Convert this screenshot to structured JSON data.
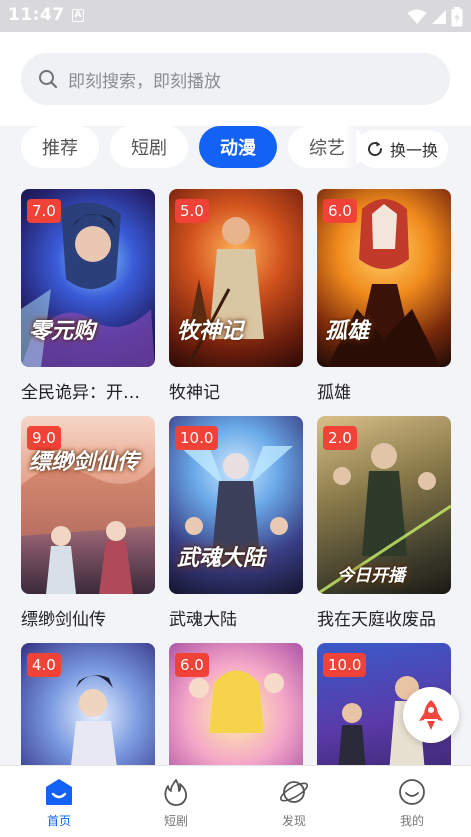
{
  "status_bar": {
    "time": "11:47",
    "notif_glyph": "A"
  },
  "search": {
    "placeholder": "即刻搜索，即刻播放"
  },
  "tabs": [
    {
      "label": "推荐",
      "active": false
    },
    {
      "label": "短剧",
      "active": false
    },
    {
      "label": "动漫",
      "active": true
    },
    {
      "label": "综艺",
      "active": false
    }
  ],
  "refresh_label": "换一换",
  "cards": [
    {
      "title": "全民诡异：开…",
      "rating": "7.0"
    },
    {
      "title": "牧神记",
      "rating": "5.0"
    },
    {
      "title": "孤雄",
      "rating": "6.0"
    },
    {
      "title": "缥缈剑仙传",
      "rating": "9.0"
    },
    {
      "title": "武魂大陆",
      "rating": "10.0"
    },
    {
      "title": "我在天庭收废品",
      "rating": "2.0"
    },
    {
      "title": "",
      "rating": "4.0"
    },
    {
      "title": "",
      "rating": "6.0"
    },
    {
      "title": "",
      "rating": "10.0"
    }
  ],
  "cover_art_text": [
    "零元购",
    "牧神记",
    "孤雄",
    "缥缈剑仙传",
    "武魂大陆",
    "今日开播",
    "",
    "",
    ""
  ],
  "bottom_nav": [
    {
      "label": "首页",
      "icon": "home-icon",
      "active": true
    },
    {
      "label": "短剧",
      "icon": "flame-icon",
      "active": false
    },
    {
      "label": "发现",
      "icon": "planet-icon",
      "active": false
    },
    {
      "label": "我的",
      "icon": "smile-icon",
      "active": false
    }
  ],
  "colors": {
    "accent": "#1362f5",
    "rating_badge": "#f04237",
    "background": "#f3f4f8"
  }
}
